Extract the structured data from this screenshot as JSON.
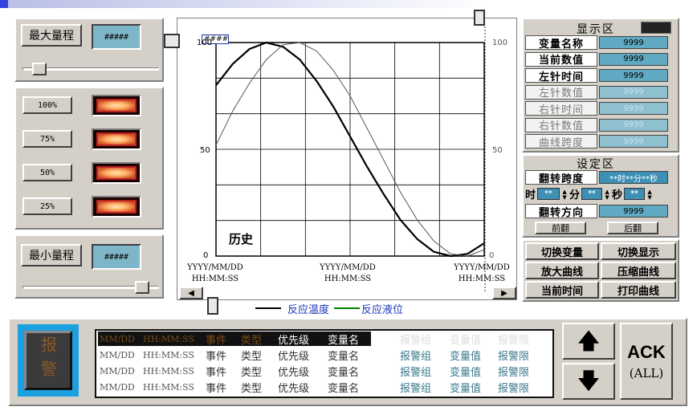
{
  "left": {
    "max_range_label": "最大量程",
    "max_range_value": "#####",
    "max_slider_pos": 0.08,
    "levels": [
      "100%",
      "75%",
      "50%",
      "25%"
    ],
    "min_range_label": "最小量程",
    "min_range_value": "#####",
    "min_slider_pos": 0.92
  },
  "chart": {
    "cursor_label": "####",
    "history_label": "历史",
    "left_axis": [
      "100",
      "50",
      "0"
    ],
    "right_axis": [
      "100",
      "50",
      "0"
    ],
    "time_labels": [
      {
        "date": "YYYY/MM/DD",
        "time": "HH:MM:SS"
      },
      {
        "date": "YYYY/MM/DD",
        "time": "HH:MM:SS"
      },
      {
        "date": "YYYY/MM/DD",
        "time": "HH:MM:SS"
      }
    ],
    "legend": [
      {
        "label": "反应温度",
        "color": "#000000"
      },
      {
        "label": "反应液位",
        "color": "#008000"
      }
    ]
  },
  "chart_data": {
    "type": "line",
    "ylim": [
      0,
      100
    ],
    "series": [
      {
        "name": "反应温度",
        "color": "#000000",
        "values": [
          80,
          90,
          97,
          100,
          98,
          92,
          82,
          70,
          56,
          42,
          29,
          17,
          8,
          2,
          0,
          1,
          6
        ]
      },
      {
        "name": "反应液位",
        "color": "#555555",
        "values": [
          52,
          68,
          81,
          92,
          99,
          100,
          96,
          87,
          75,
          60,
          45,
          30,
          17,
          7,
          1,
          0,
          3
        ]
      }
    ]
  },
  "display": {
    "title": "显示区",
    "rows": [
      {
        "label": "变量名称",
        "value": "9999",
        "dim": false
      },
      {
        "label": "当前数值",
        "value": "9999",
        "dim": false
      },
      {
        "label": "左针时间",
        "value": "9999",
        "dim": false
      },
      {
        "label": "左针数值",
        "value": "9999",
        "dim": true
      },
      {
        "label": "右针时间",
        "value": "9999",
        "dim": true
      },
      {
        "label": "右针数值",
        "value": "9999",
        "dim": true
      },
      {
        "label": "曲线跨度",
        "value": "9999",
        "dim": true
      }
    ]
  },
  "settings": {
    "title": "设定区",
    "span_label": "翻转跨度",
    "span_value": "**时**分**秒",
    "hour_label": "时",
    "hour_value": "**",
    "minute_label": "分",
    "minute_value": "**",
    "second_label": "秒",
    "second_value": "**",
    "direction_label": "翻转方向",
    "direction_value": "9999",
    "forward_button": "前翻",
    "backward_button": "后翻"
  },
  "actions": {
    "switch_var": "切换变量",
    "switch_display": "切换显示",
    "zoom_in": "放大曲线",
    "zoom_out": "压缩曲线",
    "current_time": "当前时间",
    "print_curve": "打印曲线"
  },
  "alarm": {
    "icon_text": "报警",
    "rows": [
      {
        "date": "MM/DD",
        "time": "HH:MM:SS",
        "event": "事件",
        "type": "类型",
        "priority": "优先级",
        "var": "变量名",
        "group": "报警组",
        "value": "变量值",
        "limit": "报警限",
        "selected": true
      },
      {
        "date": "MM/DD",
        "time": "HH:MM:SS",
        "event": "事件",
        "type": "类型",
        "priority": "优先级",
        "var": "变量名",
        "group": "报警组",
        "value": "变量值",
        "limit": "报警限",
        "selected": false
      },
      {
        "date": "MM/DD",
        "time": "HH:MM:SS",
        "event": "事件",
        "type": "类型",
        "priority": "优先级",
        "var": "变量名",
        "group": "报警组",
        "value": "变量值",
        "limit": "报警限",
        "selected": false
      },
      {
        "date": "MM/DD",
        "time": "HH:MM:SS",
        "event": "事件",
        "type": "类型",
        "priority": "优先级",
        "var": "变量名",
        "group": "报警组",
        "value": "变量值",
        "limit": "报警限",
        "selected": false
      }
    ],
    "ack_label": "ACK",
    "ack_all_label": "(ALL)"
  },
  "colors": {
    "panel_bg": "#d4d0c8",
    "field_blue": "#7eb6c9",
    "alarm_selected_bg": "#111111",
    "alarm_icon_frame": "#1ca0e0"
  }
}
